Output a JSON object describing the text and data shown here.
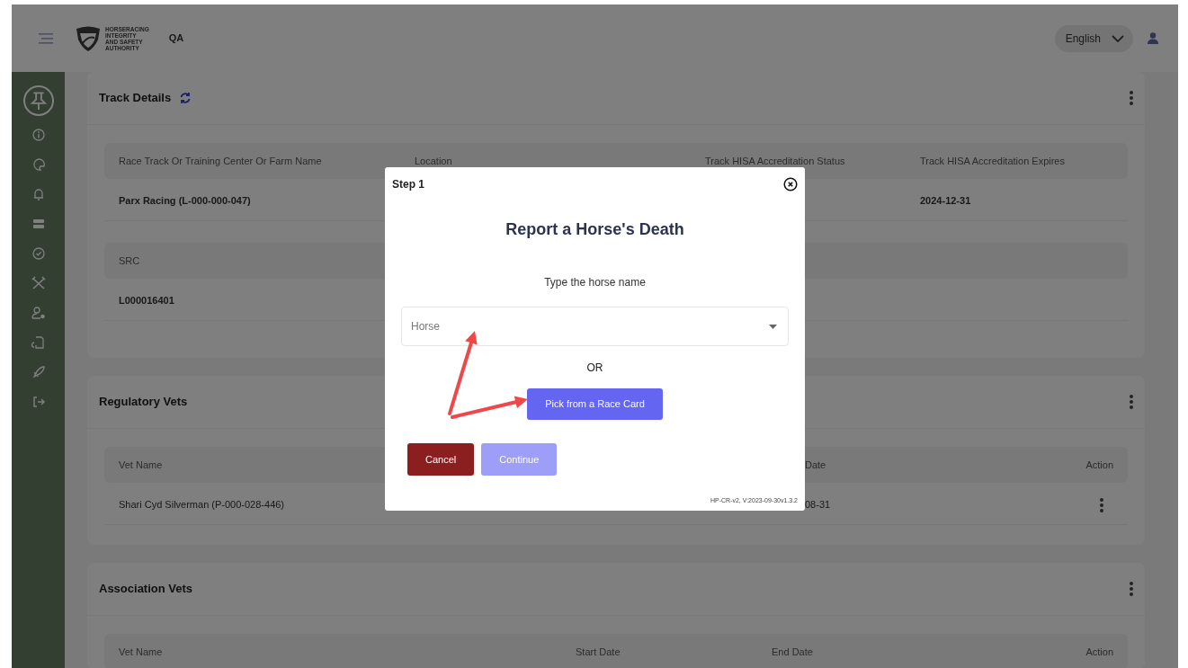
{
  "header": {
    "logo_lines": [
      "HORSERACING",
      "INTEGRITY",
      "AND SAFETY",
      "AUTHORITY"
    ],
    "environment": "QA",
    "language": "English"
  },
  "sections": [
    {
      "title": "Track Details",
      "refresh": true,
      "tables": [
        {
          "kind": "details",
          "columns": [
            "Race Track Or Training Center Or Farm Name",
            "Location",
            "Track HISA Accreditation Status",
            "Track HISA Accreditation Expires"
          ],
          "rows": [
            [
              "Parx Racing (L-000-000-047)",
              null,
              null,
              "2024-12-31"
            ]
          ]
        },
        {
          "kind": "single",
          "columns": [
            "SRC"
          ],
          "rows": [
            [
              "L000016401"
            ]
          ]
        }
      ]
    },
    {
      "title": "Regulatory Vets",
      "refresh": false,
      "tables": [
        {
          "kind": "vets_covered",
          "columns": [
            "Vet Name",
            null,
            "Date",
            "Action"
          ],
          "rows": [
            [
              "Shari Cyd Silverman (P-000-028-446)",
              null,
              "08-31",
              null
            ]
          ]
        }
      ]
    },
    {
      "title": "Association Vets",
      "refresh": false,
      "tables": [
        {
          "kind": "vets",
          "columns": [
            "Vet Name",
            "Start Date",
            "End Date",
            "Action"
          ]
        }
      ]
    }
  ],
  "modal": {
    "step": "Step 1",
    "title": "Report a Horse's Death",
    "prompt": "Type the horse name",
    "select": {
      "placeholder": "Horse"
    },
    "separator": "OR",
    "pick_button": "Pick from a Race Card",
    "buttons": [
      {
        "kind": "cancel",
        "label": "Cancel",
        "disabled": false
      },
      {
        "kind": "continue",
        "label": "Continue",
        "disabled": true
      }
    ],
    "version": "HP-CR-v2, V:2023-09-30v1.3.2"
  }
}
